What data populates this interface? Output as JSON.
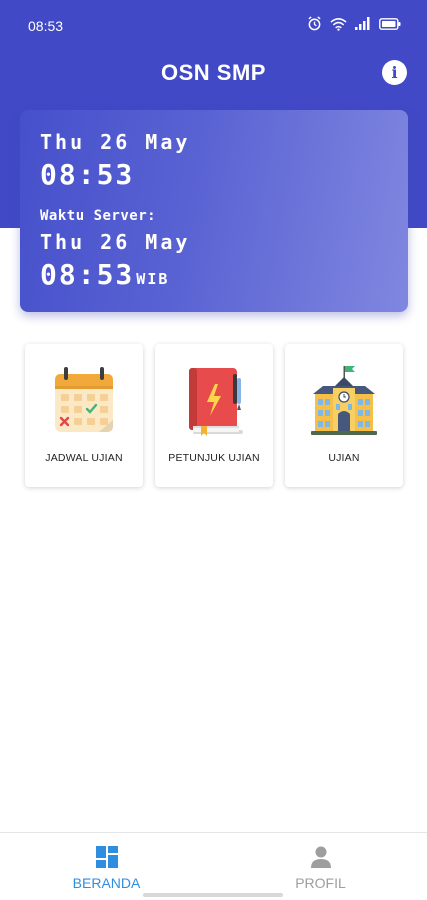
{
  "status_bar": {
    "time": "08:53",
    "icons": [
      "alarm-icon",
      "wifi-icon",
      "signal-icon",
      "battery-icon"
    ]
  },
  "header": {
    "title": "OSN SMP",
    "info_icon": "i",
    "background_color": "#4149c6"
  },
  "clock": {
    "device_date": "Thu 26 May",
    "device_time": "08:53",
    "server_label": "Waktu Server:",
    "server_date": "Thu 26 May",
    "server_time": "08:53",
    "server_timezone": "WIB"
  },
  "menu": [
    {
      "label": "JADWAL UJIAN",
      "icon": "calendar-icon"
    },
    {
      "label": "PETUNJUK UJIAN",
      "icon": "book-icon"
    },
    {
      "label": "UJIAN",
      "icon": "school-building-icon"
    }
  ],
  "bottom_nav": {
    "items": [
      {
        "label": "BERANDA",
        "icon": "dashboard-icon",
        "active": true,
        "color": "#2f8ee0"
      },
      {
        "label": "PROFIL",
        "icon": "person-icon",
        "active": false,
        "color": "#9e9e9e"
      }
    ]
  }
}
